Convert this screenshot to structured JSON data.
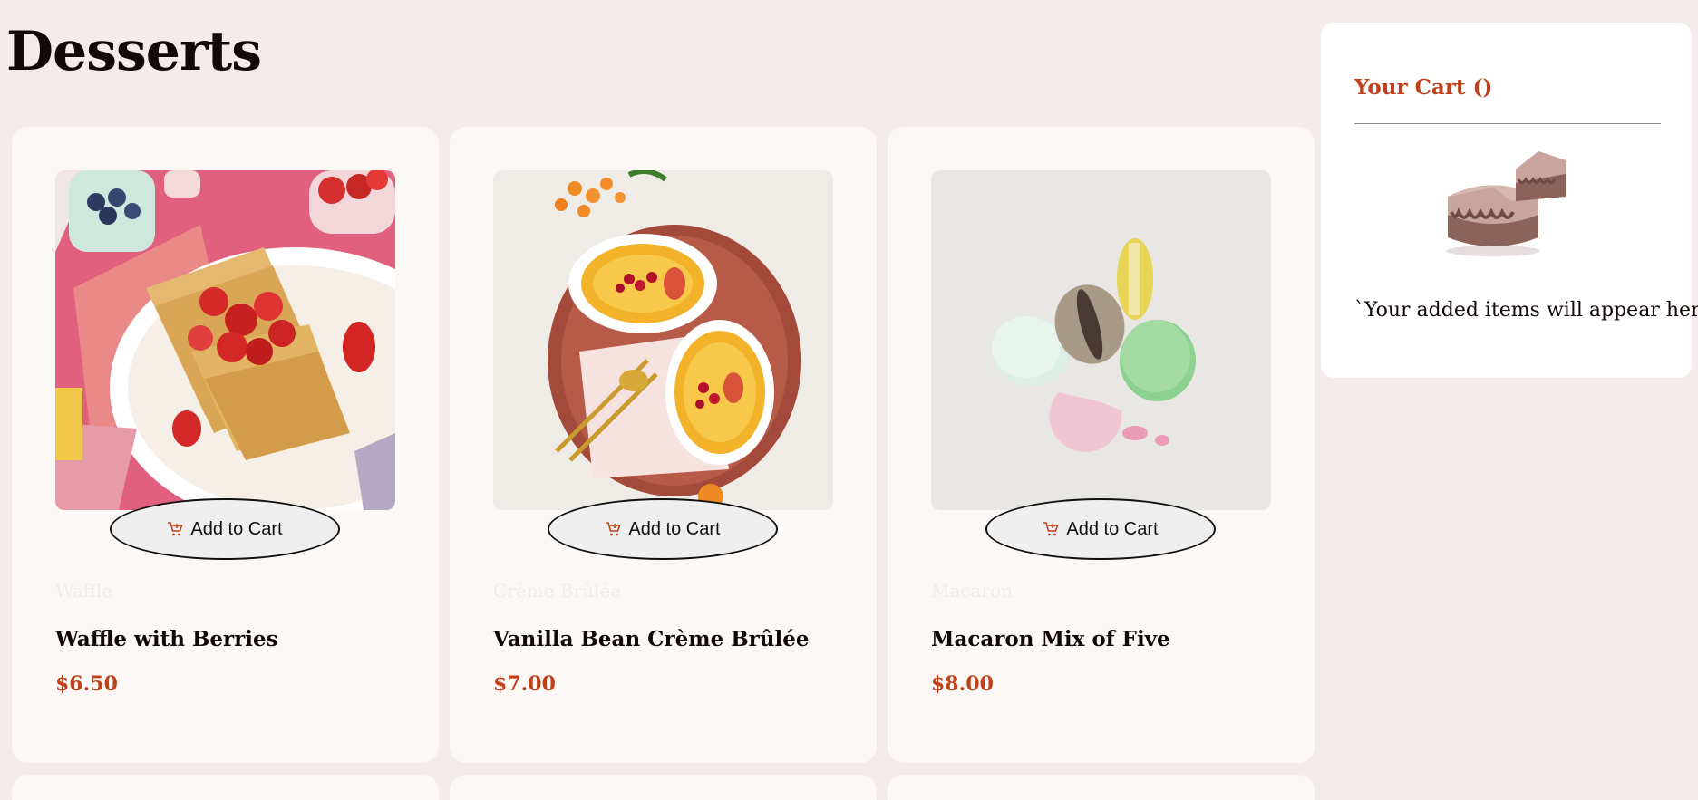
{
  "page": {
    "title": "Desserts"
  },
  "products": [
    {
      "category": "Waffle",
      "name": "Waffle with Berries",
      "price": "$6.50",
      "button_label": "Add to Cart",
      "image_icon": "waffle-image"
    },
    {
      "category": "Crème Brûlée",
      "name": "Vanilla Bean Crème Brûlée",
      "price": "$7.00",
      "button_label": "Add to Cart",
      "image_icon": "creme-brulee-image"
    },
    {
      "category": "Macaron",
      "name": "Macaron Mix of Five",
      "price": "$8.00",
      "button_label": "Add to Cart",
      "image_icon": "macaron-image"
    }
  ],
  "cart": {
    "title": "Your Cart ()",
    "empty_message": "`Your added items will appear here",
    "illustration_icon": "empty-cart-cake-icon"
  },
  "colors": {
    "background": "#f4ecea",
    "accent": "#c0401a",
    "card": "#fcf8f6"
  }
}
